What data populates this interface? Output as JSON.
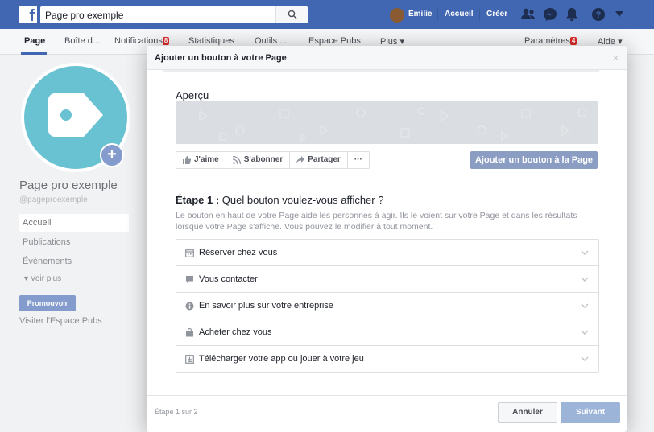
{
  "topbar": {
    "search_value": "Page pro exemple",
    "user_name": "Emilie",
    "accueil": "Accueil",
    "creer": "Créer",
    "colors": {
      "brand": "#4267b2"
    }
  },
  "nav": {
    "page": "Page",
    "inbox": "Boîte d...",
    "notifications": "Notifications",
    "notifications_badge": "8",
    "stats": "Statistiques",
    "tools": "Outils ...",
    "pubs": "Espace Pubs",
    "more": "Plus ▾",
    "settings": "Paramètres",
    "settings_badge": "4",
    "help": "Aide ▾"
  },
  "sidebar": {
    "page_name": "Page pro exemple",
    "handle": "@pageproexemple",
    "items": [
      "Accueil",
      "Publications",
      "Évènements"
    ],
    "voir_plus": "▾  Voir plus",
    "promote": "Promouvoir",
    "visit_pubs": "Visiter l'Espace Pubs",
    "add_photo": "+"
  },
  "modal": {
    "title": "Ajouter un bouton à votre Page",
    "close": "×",
    "apercu": "Aperçu",
    "actions": {
      "like": "J'aime",
      "subscribe": "S'abonner",
      "share": "Partager",
      "more": "···"
    },
    "add_button": "Ajouter un bouton à la Page",
    "step_bold": "Étape 1 :",
    "step_rest": " Quel bouton voulez-vous afficher ?",
    "step_desc": "Le bouton en haut de votre Page aide les personnes à agir. Ils le voient sur votre Page et dans les résultats lorsque votre Page s'affiche. Vous pouvez le modifier à tout moment.",
    "options": [
      {
        "label": "Réserver chez vous",
        "icon": "calendar-icon"
      },
      {
        "label": "Vous contacter",
        "icon": "chat-icon"
      },
      {
        "label": "En savoir plus sur votre entreprise",
        "icon": "info-icon"
      },
      {
        "label": "Acheter chez vous",
        "icon": "shopping-bag-icon"
      },
      {
        "label": "Télécharger votre app ou jouer à votre jeu",
        "icon": "download-icon"
      }
    ],
    "step_count": "Étape 1 sur 2",
    "cancel": "Annuler",
    "next": "Suivant"
  }
}
